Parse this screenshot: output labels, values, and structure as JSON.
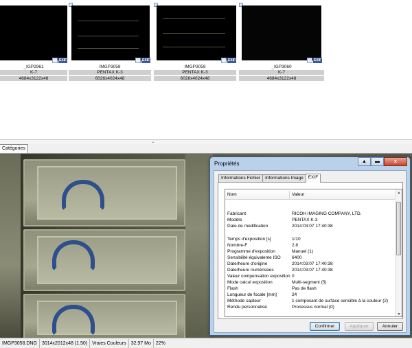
{
  "thumbnails": [
    {
      "name": "_IGP2961",
      "camera": "K-7",
      "dims": "4684x3122x48"
    },
    {
      "name": "IMGP3058",
      "camera": "PENTAX K-3",
      "dims": "6026x4024x48"
    },
    {
      "name": "IMGP3059",
      "camera": "PENTAX K-3",
      "dims": "6026x4024x48"
    },
    {
      "name": "_IGP3060",
      "camera": "K-7",
      "dims": "4684x3122x48"
    }
  ],
  "badges": {
    "exif": "EXIF"
  },
  "splitter": {
    "grip": "⌄"
  },
  "viewer": {
    "tab_label": "Catégories"
  },
  "statusbar": {
    "filename": "IMGP3058.DNG",
    "dims": "3014x2012x48 (1.50)",
    "color": "Vraies Couleurs",
    "size": "32.97 Mo",
    "zoom": "22%"
  },
  "dialog": {
    "title": "Propriétés",
    "caption_buttons": {
      "minimize": "▲",
      "maximize": "▬",
      "close": "x"
    },
    "tabs": [
      "Informations Fichier",
      "Informations Image",
      "EXIF"
    ],
    "active_tab": "EXIF",
    "columns": {
      "name": "Nom",
      "value": "Valeur"
    },
    "scroll": {
      "up": "▲",
      "down": "▼"
    },
    "rows": [
      {
        "key": "Fabricant",
        "value": "RICOH IMAGING COMPANY, LTD."
      },
      {
        "key": "Modèle",
        "value": "PENTAX K-3"
      },
      {
        "key": "Date de modification",
        "value": "2014:03:07 17:40:38"
      },
      {
        "key": "Temps d'exposition [s]",
        "value": "1/10"
      },
      {
        "key": "Nombre-F",
        "value": "2.8"
      },
      {
        "key": "Programme d'exposition",
        "value": "Manuel (1)"
      },
      {
        "key": "Sensibilité équivalente ISO",
        "value": "6400"
      },
      {
        "key": "Date/heure d'origine",
        "value": "2014:03:07 17:40:38"
      },
      {
        "key": "Date/heure numérisées",
        "value": "2014:03:07 17:40:38"
      },
      {
        "key": "Valeur compensation exposition",
        "value": "0"
      },
      {
        "key": "Mode calcul exposition",
        "value": "Multi-segment (5)"
      },
      {
        "key": "Flash",
        "value": "Pas de flash"
      },
      {
        "key": "Longueur de focale [mm]",
        "value": "24"
      },
      {
        "key": "Méthode capteur",
        "value": "1 composant de surface sensible à la couleur (2)"
      },
      {
        "key": "Rendu personnalisé",
        "value": "Processus normal (0)"
      }
    ],
    "buttons": {
      "ok": "Confirmer",
      "apply": "Appliquer",
      "cancel": "Annuler"
    }
  }
}
